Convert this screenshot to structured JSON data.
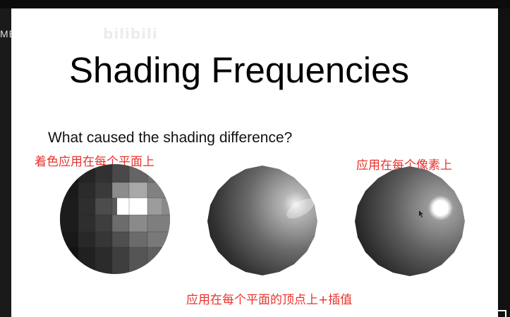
{
  "watermark": {
    "text": "MEET WEIWANG",
    "logo": "bilibili"
  },
  "slide": {
    "title": "Shading Frequencies",
    "question": "What caused the shading difference?",
    "annotations": {
      "flat": "着色应用在每个平面上",
      "phong": "应用在每个像素上",
      "gouraud": "应用在每个平面的顶点上+插值"
    },
    "spheres": [
      "flat-shaded-sphere",
      "gouraud-shaded-sphere",
      "phong-shaded-sphere"
    ]
  },
  "colors": {
    "annotation": "#e8322b",
    "background": "#ffffff",
    "frame": "#000000"
  }
}
